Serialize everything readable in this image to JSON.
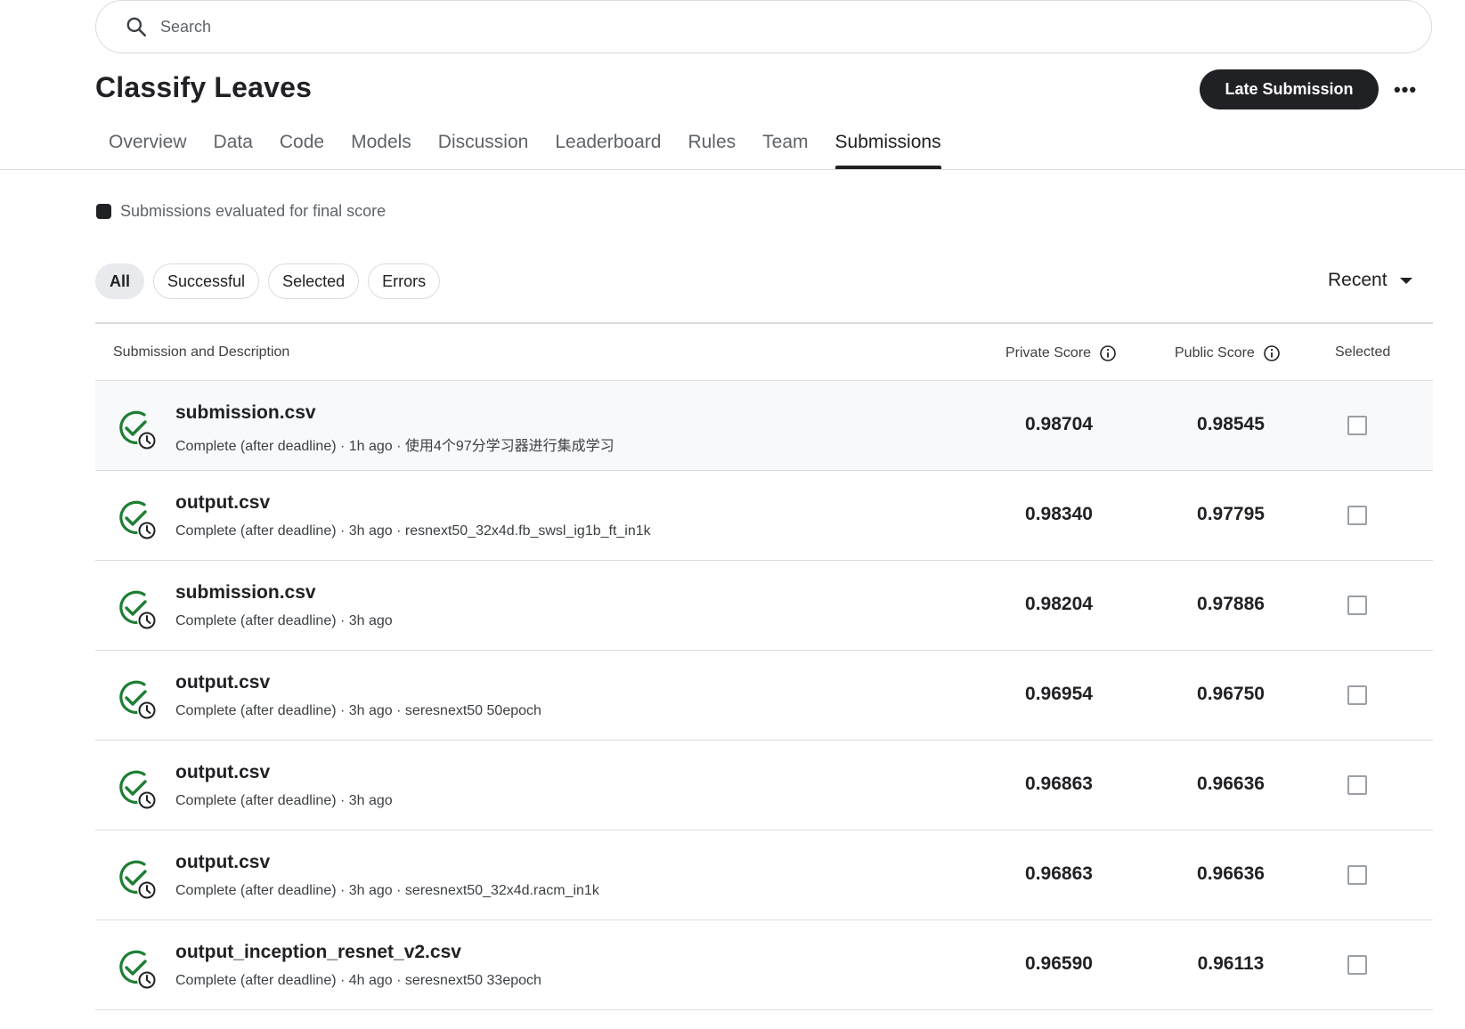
{
  "search": {
    "placeholder": "Search"
  },
  "competition": {
    "title": "Classify Leaves"
  },
  "actions": {
    "late_submission_label": "Late Submission",
    "more_label": "•••"
  },
  "tabs": [
    {
      "label": "Overview",
      "active": false
    },
    {
      "label": "Data",
      "active": false
    },
    {
      "label": "Code",
      "active": false
    },
    {
      "label": "Models",
      "active": false
    },
    {
      "label": "Discussion",
      "active": false
    },
    {
      "label": "Leaderboard",
      "active": false
    },
    {
      "label": "Rules",
      "active": false
    },
    {
      "label": "Team",
      "active": false
    },
    {
      "label": "Submissions",
      "active": true
    }
  ],
  "legend": {
    "text": "Submissions evaluated for final score"
  },
  "filters": [
    {
      "label": "All",
      "active": true
    },
    {
      "label": "Successful",
      "active": false
    },
    {
      "label": "Selected",
      "active": false
    },
    {
      "label": "Errors",
      "active": false
    }
  ],
  "sort": {
    "label": "Recent"
  },
  "table": {
    "headers": {
      "submission": "Submission and Description",
      "private": "Private Score",
      "public": "Public Score",
      "selected": "Selected"
    },
    "rows": [
      {
        "name": "submission.csv",
        "meta": "Complete (after deadline) · 1h ago · 使用4个97分学习器进行集成学习",
        "private": "0.98704",
        "public": "0.98545",
        "selected": false
      },
      {
        "name": "output.csv",
        "meta": "Complete (after deadline) · 3h ago · resnext50_32x4d.fb_swsl_ig1b_ft_in1k",
        "private": "0.98340",
        "public": "0.97795",
        "selected": false
      },
      {
        "name": "submission.csv",
        "meta": "Complete (after deadline) · 3h ago",
        "private": "0.98204",
        "public": "0.97886",
        "selected": false
      },
      {
        "name": "output.csv",
        "meta": "Complete (after deadline) · 3h ago · seresnext50 50epoch",
        "private": "0.96954",
        "public": "0.96750",
        "selected": false
      },
      {
        "name": "output.csv",
        "meta": "Complete (after deadline) · 3h ago",
        "private": "0.96863",
        "public": "0.96636",
        "selected": false
      },
      {
        "name": "output.csv",
        "meta": "Complete (after deadline) · 3h ago · seresnext50_32x4d.racm_in1k",
        "private": "0.96863",
        "public": "0.96636",
        "selected": false
      },
      {
        "name": "output_inception_resnet_v2.csv",
        "meta": "Complete (after deadline) · 4h ago · seresnext50 33epoch",
        "private": "0.96590",
        "public": "0.96113",
        "selected": false
      }
    ]
  },
  "colors": {
    "status_green": "#1e7e34",
    "primary_dark": "#202124",
    "divider": "#dadce0"
  },
  "icons": {
    "search": "search-icon",
    "info": "info-icon",
    "status": "complete-late-icon",
    "more": "more-horizontal-icon"
  }
}
